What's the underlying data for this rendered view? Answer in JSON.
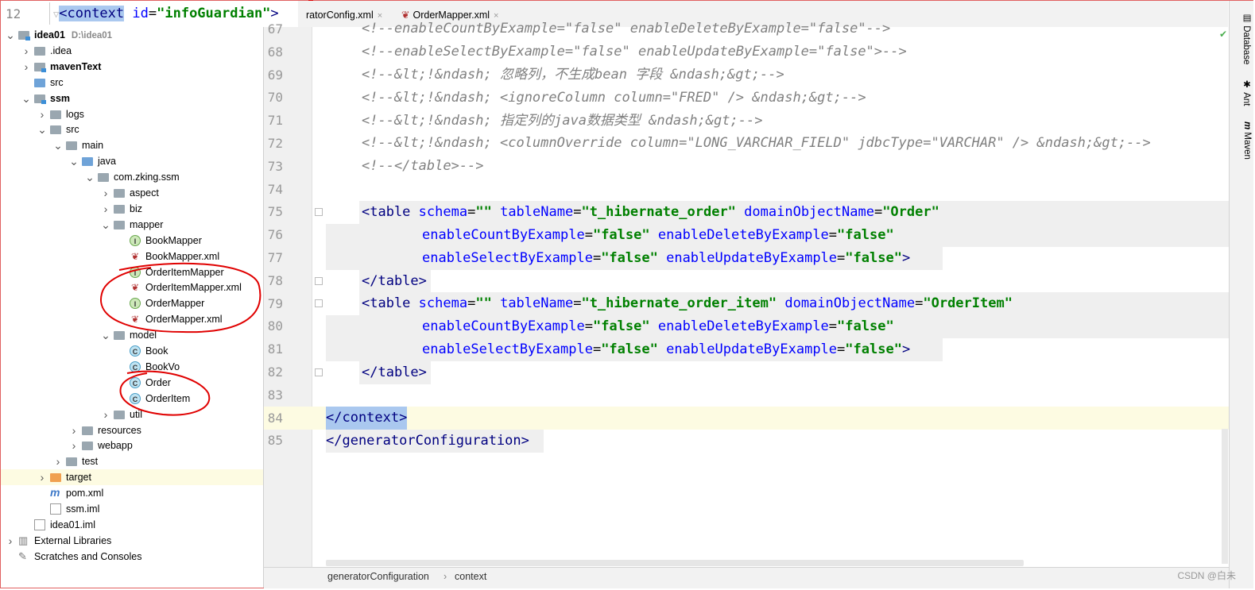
{
  "tree_header": {
    "line_number": "12",
    "context_popup": {
      "open": "<",
      "tag": "context",
      "attr": "id",
      "eq": "=",
      "value": "\"infoGuardian\"",
      "close": ">"
    }
  },
  "tabs": [
    {
      "label": "ratorConfig.xml",
      "close": "×"
    },
    {
      "label": "OrderMapper.xml",
      "close": "×"
    }
  ],
  "project_tree": {
    "items": [
      {
        "label": "idea01",
        "path": "D:\\idea01",
        "bold": true
      },
      {
        "label": ".idea"
      },
      {
        "label": "mavenText",
        "bold": true
      },
      {
        "label": "src"
      },
      {
        "label": "ssm",
        "bold": true
      },
      {
        "label": "logs"
      },
      {
        "label": "src"
      },
      {
        "label": "main"
      },
      {
        "label": "java"
      },
      {
        "label": "com.zking.ssm"
      },
      {
        "label": "aspect"
      },
      {
        "label": "biz"
      },
      {
        "label": "mapper"
      },
      {
        "label": "BookMapper"
      },
      {
        "label": "BookMapper.xml"
      },
      {
        "label": "OrderItemMapper"
      },
      {
        "label": "OrderItemMapper.xml"
      },
      {
        "label": "OrderMapper"
      },
      {
        "label": "OrderMapper.xml"
      },
      {
        "label": "model"
      },
      {
        "label": "Book"
      },
      {
        "label": "BookVo"
      },
      {
        "label": "Order"
      },
      {
        "label": "OrderItem"
      },
      {
        "label": "util"
      },
      {
        "label": "resources"
      },
      {
        "label": "webapp"
      },
      {
        "label": "test"
      },
      {
        "label": "target"
      },
      {
        "label": "pom.xml"
      },
      {
        "label": "ssm.iml"
      },
      {
        "label": "idea01.iml"
      },
      {
        "label": "External Libraries"
      },
      {
        "label": "Scratches and Consoles"
      }
    ]
  },
  "editor": {
    "lines": [
      {
        "n": "67",
        "t": "<!--enableCountByExample=\"false\" enableDeleteByExample=\"false\"-->"
      },
      {
        "n": "68",
        "t": "<!--enableSelectByExample=\"false\" enableUpdateByExample=\"false\">-->"
      },
      {
        "n": "69",
        "t": "<!--&lt;!&ndash; 忽略列，不生成bean 字段 &ndash;&gt;-->"
      },
      {
        "n": "70",
        "t": "<!--&lt;!&ndash; <ignoreColumn column=\"FRED\" /> &ndash;&gt;-->"
      },
      {
        "n": "71",
        "t": "<!--&lt;!&ndash; 指定列的java数据类型 &ndash;&gt;-->"
      },
      {
        "n": "72",
        "t": "<!--&lt;!&ndash; <columnOverride column=\"LONG_VARCHAR_FIELD\" jdbcType=\"VARCHAR\" /> &ndash;&gt;-->"
      },
      {
        "n": "73",
        "t": "<!--</table>-->"
      },
      {
        "n": "74",
        "t": ""
      },
      {
        "n": "75",
        "t": ""
      },
      {
        "n": "76",
        "t": ""
      },
      {
        "n": "77",
        "t": ""
      },
      {
        "n": "78",
        "t": ""
      },
      {
        "n": "79",
        "t": ""
      },
      {
        "n": "80",
        "t": ""
      },
      {
        "n": "81",
        "t": ""
      },
      {
        "n": "82",
        "t": ""
      },
      {
        "n": "83",
        "t": ""
      },
      {
        "n": "84",
        "t": ""
      },
      {
        "n": "85",
        "t": ""
      }
    ],
    "code": {
      "l75_open": "<table",
      "l75_a1": "schema",
      "l75_v1": "\"\"",
      "l75_a2": "tableName",
      "l75_v2": "\"t_hibernate_order\"",
      "l75_a3": "domainObjectName",
      "l75_v3": "\"Order\"",
      "l76_a1": "enableCountByExample",
      "l76_v1": "\"false\"",
      "l76_a2": "enableDeleteByExample",
      "l76_v2": "\"false\"",
      "l77_a1": "enableSelectByExample",
      "l77_v1": "\"false\"",
      "l77_a2": "enableUpdateByExample",
      "l77_v2": "\"false\"",
      "l77_close": ">",
      "l78": "</table>",
      "l79_open": "<table",
      "l79_a1": "schema",
      "l79_v1": "\"\"",
      "l79_a2": "tableName",
      "l79_v2": "\"t_hibernate_order_item\"",
      "l79_a3": "domainObjectName",
      "l79_v3": "\"OrderItem\"",
      "l80_a1": "enableCountByExample",
      "l80_v1": "\"false\"",
      "l80_a2": "enableDeleteByExample",
      "l80_v2": "\"false\"",
      "l81_a1": "enableSelectByExample",
      "l81_v1": "\"false\"",
      "l81_a2": "enableUpdateByExample",
      "l81_v2": "\"false\"",
      "l81_close": ">",
      "l82": "</table>",
      "l84": "</context>",
      "l85": "</generatorConfiguration>"
    }
  },
  "breadcrumb": {
    "items": [
      "generatorConfiguration",
      "context"
    ],
    "separator": "›"
  },
  "right_sidebar": {
    "items": [
      "Database",
      "Ant",
      "Maven"
    ]
  },
  "watermark": "CSDN @白未",
  "colors": {
    "annotation": "#e00000",
    "current_line": "#fdfbe2",
    "tag": "#000080",
    "attr": "#0000ff",
    "value": "#008000",
    "comment": "#808080"
  }
}
